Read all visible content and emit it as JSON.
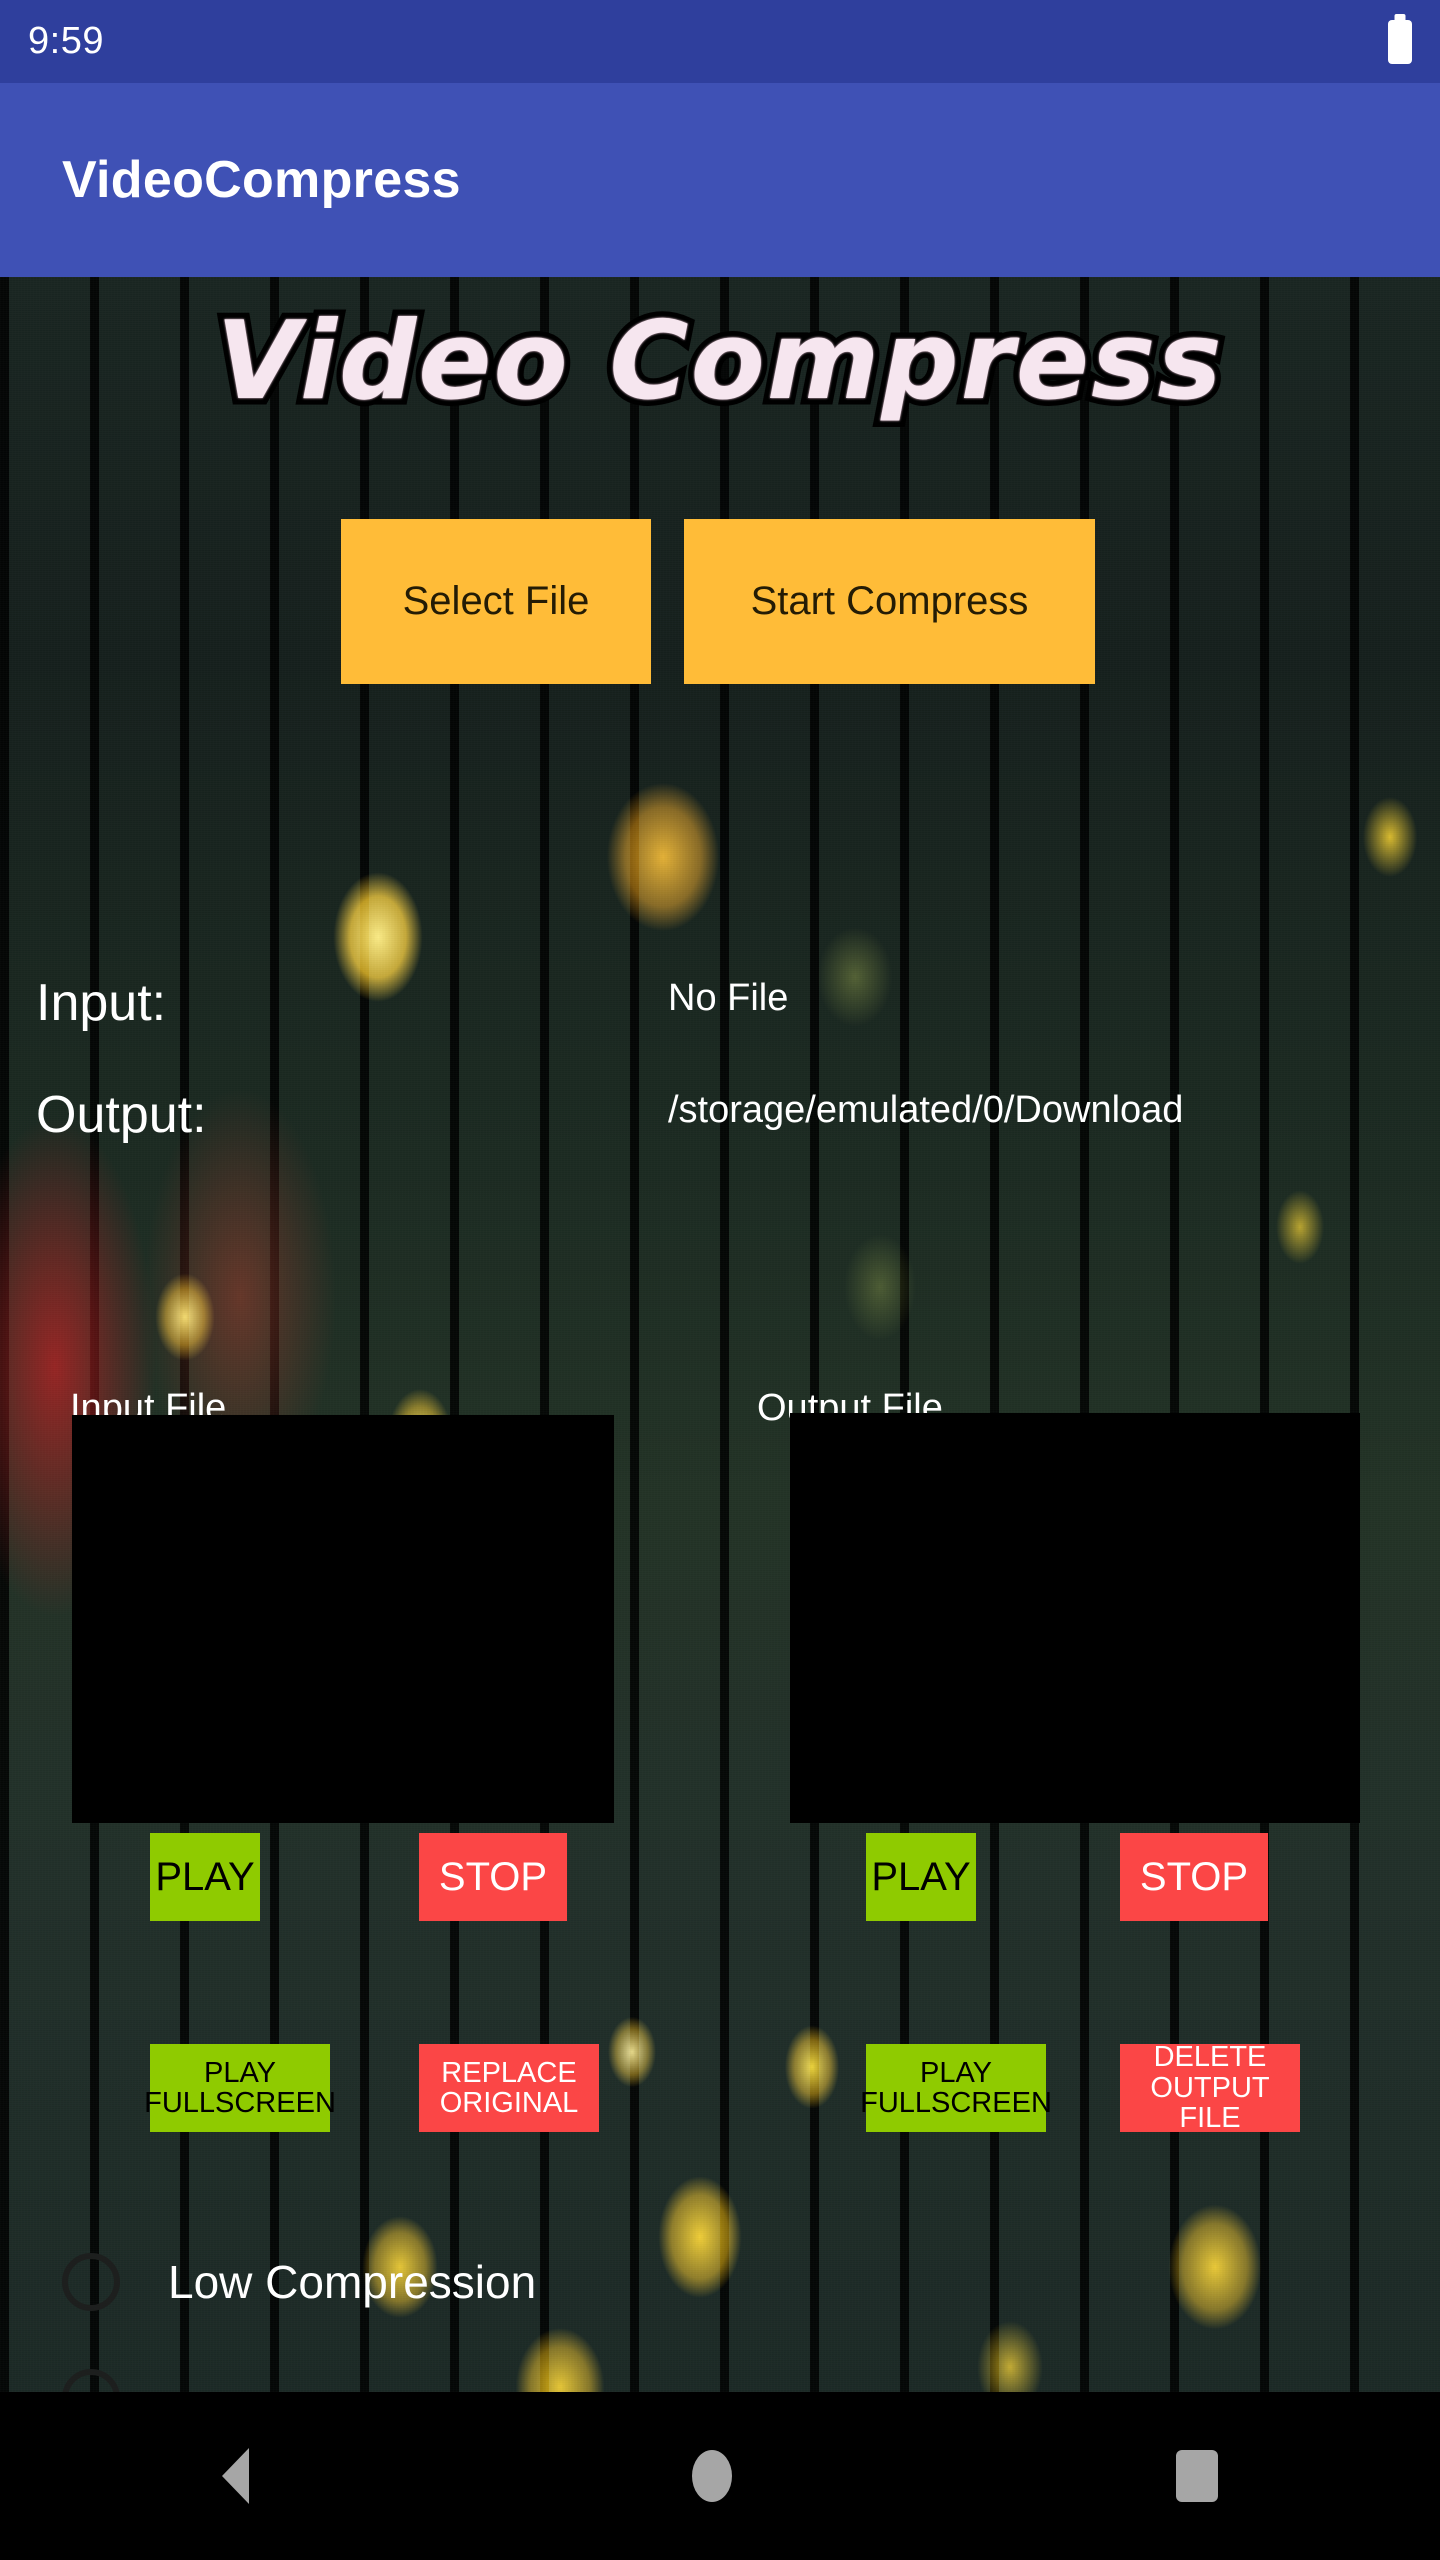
{
  "status_bar": {
    "time": "9:59",
    "battery_icon": "battery-full-icon",
    "background_color": "#2F3F9D"
  },
  "app_bar": {
    "title": "VideoCompress",
    "background_color": "#3F51B5",
    "text_color": "#FFFFFF"
  },
  "hero": {
    "logo_text": "Video Compress"
  },
  "actions": {
    "select_file_label": "Select File",
    "start_compress_label": "Start Compress",
    "button_color": "#FFBC38"
  },
  "info": {
    "input_label": "Input:",
    "input_value": "No File",
    "output_label": "Output:",
    "output_value": "/storage/emulated/0/Download"
  },
  "panels": [
    {
      "title": "Input File",
      "play_label": "PLAY",
      "stop_label": "STOP",
      "fullscreen_line1": "PLAY",
      "fullscreen_line2": "FULLSCREEN",
      "action_line1": "REPLACE",
      "action_line2": "ORIGINAL"
    },
    {
      "title": "Output File",
      "play_label": "PLAY",
      "stop_label": "STOP",
      "fullscreen_line1": "PLAY",
      "fullscreen_line2": "FULLSCREEN",
      "action_line1": "DELETE",
      "action_line2": "OUTPUT FILE"
    }
  ],
  "colors": {
    "play_button": "#8FCB00",
    "stop_button": "#FB4646",
    "video_surface": "#000000"
  },
  "compression_options": [
    {
      "label": "Low Compression",
      "selected": false
    },
    {
      "label": "",
      "selected": false
    }
  ],
  "nav_bar": {
    "back_icon": "back-triangle-icon",
    "home_icon": "home-circle-icon",
    "recents_icon": "recents-square-icon",
    "background_color": "#000000"
  }
}
